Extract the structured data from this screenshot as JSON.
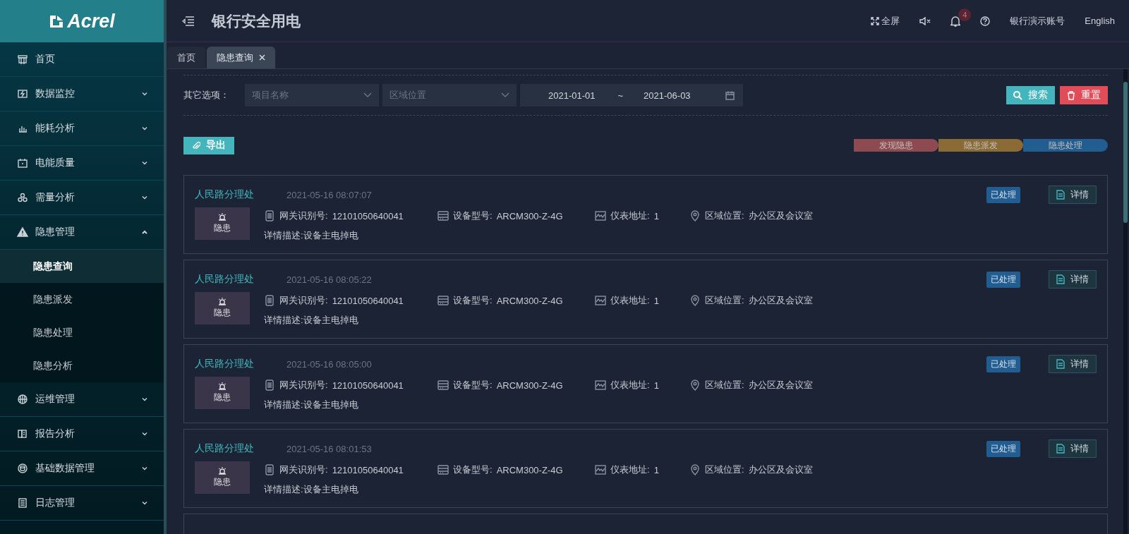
{
  "app": {
    "logo": "Acrel",
    "title": "银行安全用电"
  },
  "header_actions": {
    "fullscreen": "全屏",
    "notification_count": "4",
    "account": "银行演示账号",
    "language": "English"
  },
  "sidebar": {
    "items": [
      {
        "label": "首页"
      },
      {
        "label": "数据监控",
        "expanded": false
      },
      {
        "label": "能耗分析",
        "expanded": false
      },
      {
        "label": "电能质量",
        "expanded": false
      },
      {
        "label": "需量分析",
        "expanded": false
      },
      {
        "label": "隐患管理",
        "expanded": true,
        "children": [
          {
            "label": "隐患查询",
            "selected": true
          },
          {
            "label": "隐患派发",
            "selected": false
          },
          {
            "label": "隐患处理",
            "selected": false
          },
          {
            "label": "隐患分析",
            "selected": false
          }
        ]
      },
      {
        "label": "运维管理",
        "expanded": false
      },
      {
        "label": "报告分析",
        "expanded": false
      },
      {
        "label": "基础数据管理",
        "expanded": false
      },
      {
        "label": "日志管理",
        "expanded": false
      }
    ]
  },
  "tabs": [
    {
      "label": "首页",
      "selected": false,
      "closable": false
    },
    {
      "label": "隐患查询",
      "selected": true,
      "closable": true
    }
  ],
  "filters": {
    "label": "其它选项：",
    "project": {
      "placeholder": "项目名称"
    },
    "area": {
      "placeholder": "区域位置"
    },
    "date_start": "2021-01-01",
    "date_separator": "~",
    "date_end": "2021-06-03",
    "search_button": "搜索",
    "reset_button": "重置"
  },
  "export_button": "导出",
  "legend": [
    {
      "label": "发现隐患",
      "color": "#8e4a51"
    },
    {
      "label": "隐患派发",
      "color": "#8a6a35"
    },
    {
      "label": "隐患处理",
      "color": "#215d90"
    }
  ],
  "records": [
    {
      "branch": "人民路分理处",
      "time": "2021-05-16 08:07:07",
      "tag": "隐患",
      "gateway_label": "网关识别号:",
      "gateway": "12101050640041",
      "model_label": "设备型号:",
      "model": "ARCM300-Z-4G",
      "meter_label": "仪表地址:",
      "meter": "1",
      "area_label": "区域位置:",
      "area": "办公区及会议室",
      "description": "详情描述:设备主电掉电",
      "status": "已处理",
      "detail_button": "详情"
    },
    {
      "branch": "人民路分理处",
      "time": "2021-05-16 08:05:22",
      "tag": "隐患",
      "gateway_label": "网关识别号:",
      "gateway": "12101050640041",
      "model_label": "设备型号:",
      "model": "ARCM300-Z-4G",
      "meter_label": "仪表地址:",
      "meter": "1",
      "area_label": "区域位置:",
      "area": "办公区及会议室",
      "description": "详情描述:设备主电掉电",
      "status": "已处理",
      "detail_button": "详情"
    },
    {
      "branch": "人民路分理处",
      "time": "2021-05-16 08:05:00",
      "tag": "隐患",
      "gateway_label": "网关识别号:",
      "gateway": "12101050640041",
      "model_label": "设备型号:",
      "model": "ARCM300-Z-4G",
      "meter_label": "仪表地址:",
      "meter": "1",
      "area_label": "区域位置:",
      "area": "办公区及会议室",
      "description": "详情描述:设备主电掉电",
      "status": "已处理",
      "detail_button": "详情"
    },
    {
      "branch": "人民路分理处",
      "time": "2021-05-16 08:01:53",
      "tag": "隐患",
      "gateway_label": "网关识别号:",
      "gateway": "12101050640041",
      "model_label": "设备型号:",
      "model": "ARCM300-Z-4G",
      "meter_label": "仪表地址:",
      "meter": "1",
      "area_label": "区域位置:",
      "area": "办公区及会议室",
      "description": "详情描述:设备主电掉电",
      "status": "已处理",
      "detail_button": "详情"
    }
  ]
}
